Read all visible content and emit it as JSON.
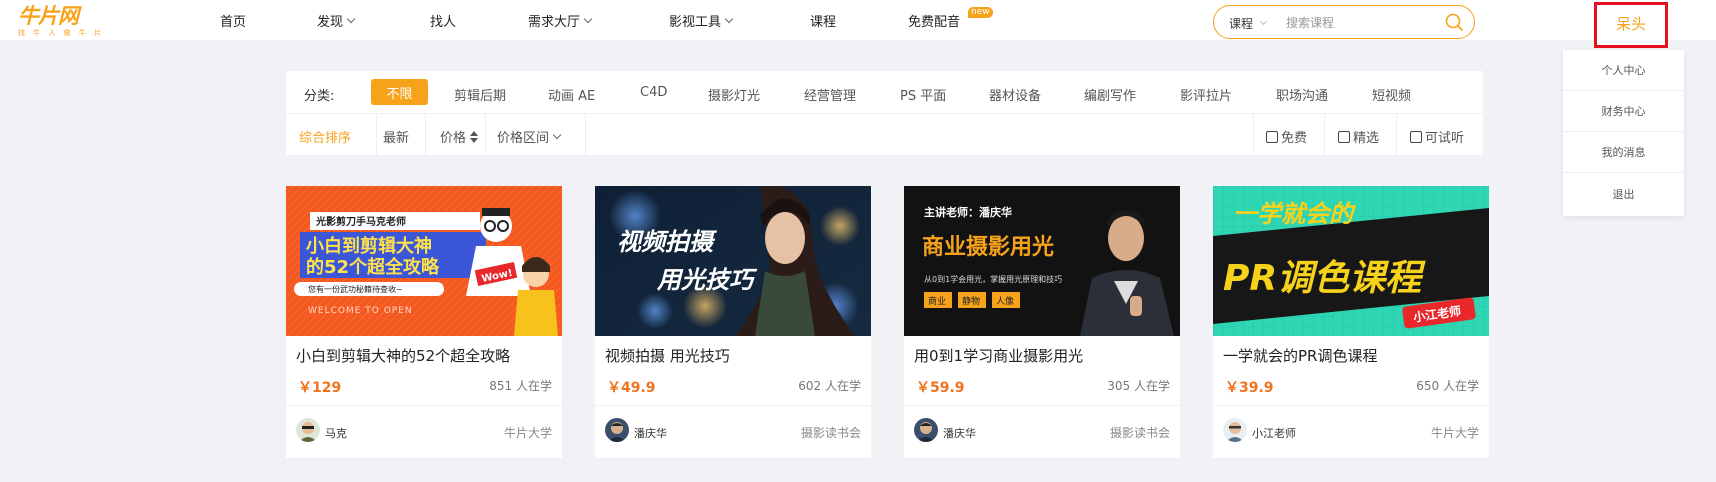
{
  "header": {
    "logo": {
      "main": "牛片网",
      "sub": "找 牛 人 做 牛 片"
    },
    "nav": [
      {
        "label": "首页",
        "dropdown": false
      },
      {
        "label": "发现",
        "dropdown": true
      },
      {
        "label": "找人",
        "dropdown": false
      },
      {
        "label": "需求大厅",
        "dropdown": true
      },
      {
        "label": "影视工具",
        "dropdown": true
      },
      {
        "label": "课程",
        "dropdown": false
      },
      {
        "label": "免费配音",
        "dropdown": false,
        "badge": "new"
      }
    ],
    "search": {
      "type": "课程",
      "placeholder": "搜索课程",
      "value": ""
    },
    "user": {
      "name": "呆头"
    }
  },
  "user_menu": {
    "items": [
      "个人中心",
      "财务中心",
      "我的消息",
      "退出"
    ]
  },
  "filter": {
    "category_label": "分类:",
    "categories": [
      "不限",
      "剪辑后期",
      "动画 AE",
      "C4D",
      "摄影灯光",
      "经营管理",
      "PS 平面",
      "器材设备",
      "编剧写作",
      "影评拉片",
      "职场沟通",
      "短视频"
    ],
    "active_category": "不限",
    "sort": [
      {
        "label": "综合排序",
        "active": true
      },
      {
        "label": "最新",
        "active": false
      },
      {
        "label": "价格",
        "active": false
      },
      {
        "label": "价格区间",
        "active": false
      }
    ],
    "checkboxes": [
      {
        "label": "免费",
        "checked": false
      },
      {
        "label": "精选",
        "checked": false
      },
      {
        "label": "可试听",
        "checked": false
      }
    ]
  },
  "courses": [
    {
      "title": "小白到剪辑大神的52个超全攻略",
      "price": "￥129",
      "learners": "851 人在学",
      "author": "马克",
      "org": "牛片大学",
      "thumb": {
        "tag": "光影剪刀手马克老师",
        "line1": "小白到剪辑大神",
        "line2": "的52个超全攻略",
        "sub": "您有一份武功秘籍待查收~",
        "foot": "WELCOME TO OPEN",
        "bubble": "Wow!"
      }
    },
    {
      "title": "视频拍摄 用光技巧",
      "price": "￥49.9",
      "learners": "602 人在学",
      "author": "潘庆华",
      "org": "摄影读书会",
      "thumb": {
        "line1": "视频拍摄",
        "line2": "用光技巧"
      }
    },
    {
      "title": "用0到1学习商业摄影用光",
      "price": "￥59.9",
      "learners": "305 人在学",
      "author": "潘庆华",
      "org": "摄影读书会",
      "thumb": {
        "tag": "主讲老师：潘庆华",
        "line1": "商业摄影用光",
        "sub": "从0到1学会用光，掌握用光原理和技巧",
        "chips": [
          "商业",
          "静物",
          "人像"
        ]
      }
    },
    {
      "title": "一学就会的PR调色课程",
      "price": "￥39.9",
      "learners": "650 人在学",
      "author": "小江老师",
      "org": "牛片大学",
      "thumb": {
        "line1": "一学就会的",
        "line2": "PR调色课程",
        "badge": "小江老师"
      }
    }
  ],
  "colors": {
    "accent": "#f7a21b",
    "price": "#f0731d",
    "highlight_border": "#e3101e",
    "page_bg": "#f1f2f5"
  }
}
